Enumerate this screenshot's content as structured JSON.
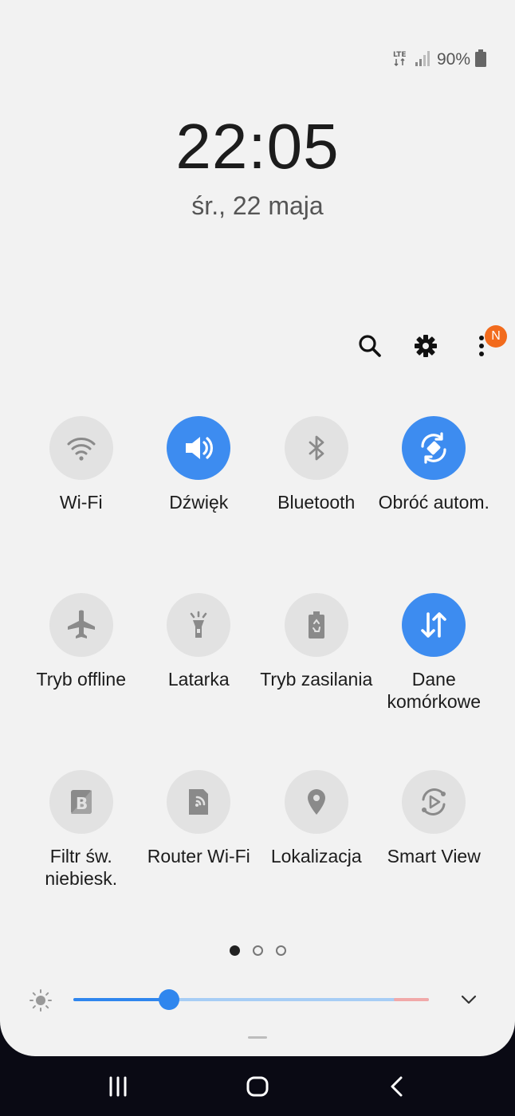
{
  "status": {
    "network": "LTE",
    "battery_percent": "90%"
  },
  "clock": {
    "time": "22:05",
    "date": "śr., 22 maja"
  },
  "toolbar": {
    "notification_badge": "N"
  },
  "tiles": [
    {
      "label": "Wi-Fi",
      "on": false,
      "icon": "wifi-icon"
    },
    {
      "label": "Dźwięk",
      "on": true,
      "icon": "sound-icon"
    },
    {
      "label": "Bluetooth",
      "on": false,
      "icon": "bluetooth-icon"
    },
    {
      "label": "Obróć autom.",
      "on": true,
      "icon": "auto-rotate-icon"
    },
    {
      "label": "Tryb offline",
      "on": false,
      "icon": "airplane-icon"
    },
    {
      "label": "Latarka",
      "on": false,
      "icon": "flashlight-icon"
    },
    {
      "label": "Tryb zasilania",
      "on": false,
      "icon": "power-mode-icon"
    },
    {
      "label": "Dane komórkowe",
      "on": true,
      "icon": "mobile-data-icon"
    },
    {
      "label": "Filtr św. niebiesk.",
      "on": false,
      "icon": "blue-light-filter-icon"
    },
    {
      "label": "Router Wi-Fi",
      "on": false,
      "icon": "wifi-hotspot-icon"
    },
    {
      "label": "Lokalizacja",
      "on": false,
      "icon": "location-icon"
    },
    {
      "label": "Smart View",
      "on": false,
      "icon": "smart-view-icon"
    }
  ],
  "pager": {
    "pages": 3,
    "active": 0
  },
  "brightness": {
    "level": 0.27
  },
  "colors": {
    "accent": "#3d8cf0",
    "tile_off": "#e2e2e2",
    "panel": "#f2f2f2"
  }
}
